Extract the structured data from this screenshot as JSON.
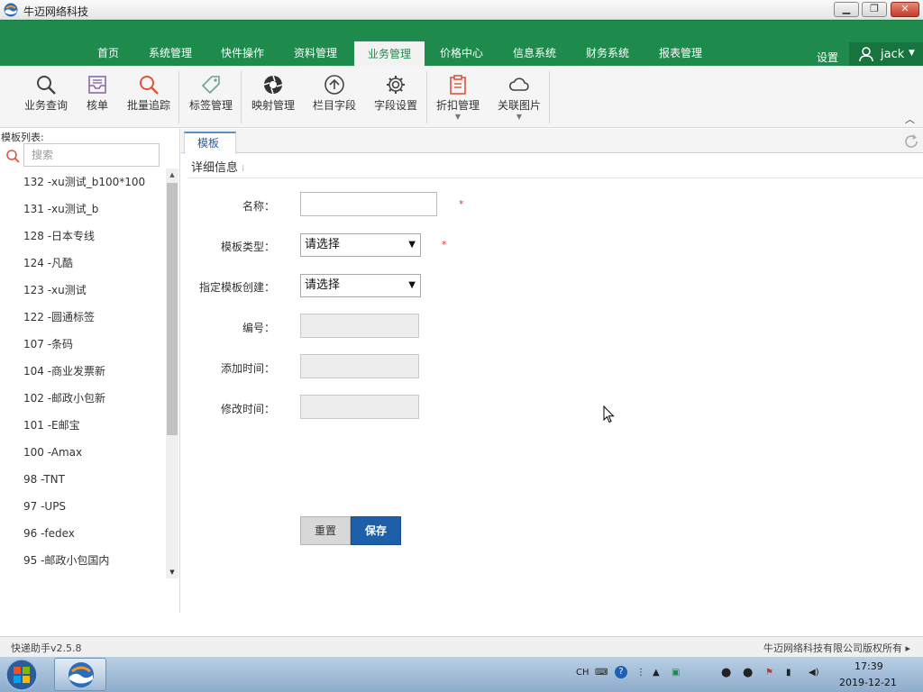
{
  "window": {
    "title": "牛迈网络科技"
  },
  "nav": {
    "items": [
      "首页",
      "系统管理",
      "快件操作",
      "资料管理",
      "业务管理",
      "价格中心",
      "信息系统",
      "财务系统",
      "报表管理"
    ],
    "active": "业务管理",
    "settings": "设置",
    "user": "jack"
  },
  "toolbar": {
    "items": [
      {
        "label": "业务查询",
        "icon": "search-icon"
      },
      {
        "label": "核单",
        "icon": "inbox-icon"
      },
      {
        "label": "批量追踪",
        "icon": "search-red-icon"
      },
      {
        "label": "标签管理",
        "icon": "tag-icon"
      },
      {
        "label": "映射管理",
        "icon": "aperture-icon"
      },
      {
        "label": "栏目字段",
        "icon": "arrow-up-circle-icon"
      },
      {
        "label": "字段设置",
        "icon": "gear-icon"
      },
      {
        "label": "折扣管理",
        "icon": "clipboard-icon"
      },
      {
        "label": "关联图片",
        "icon": "cloud-icon"
      }
    ]
  },
  "left_panel": {
    "title": "模板列表:",
    "search_placeholder": "搜索",
    "items": [
      "132 -xu测试_b100*100",
      "131 -xu测试_b",
      "128 -日本专线",
      "124 -凡酷",
      "123 -xu测试",
      "122 -圆通标签",
      "107 -条码",
      "104 -商业发票新",
      "102 -邮政小包新",
      "101 -E邮宝",
      "100 -Amax",
      "98 -TNT",
      "97 -UPS",
      "96 -fedex",
      "95 -邮政小包国内"
    ]
  },
  "main": {
    "tab": "模板",
    "section_title": "详细信息",
    "form": {
      "name_label": "名称：",
      "type_label": "模板类型：",
      "type_value": "请选择",
      "base_label": "指定模板创建：",
      "base_value": "请选择",
      "code_label": "编号：",
      "created_label": "添加时间：",
      "modified_label": "修改时间："
    },
    "reset_button": "重置",
    "save_button": "保存"
  },
  "status": {
    "version": "快递助手v2.5.8",
    "copyright": "牛迈网络科技有限公司版权所有"
  },
  "taskbar": {
    "ime": "CH",
    "time": "17:39",
    "date": "2019-12-21"
  },
  "colors": {
    "nav_green": "#1e8a4c",
    "primary_blue": "#1d5fa8",
    "required_red": "#d63a3a"
  }
}
